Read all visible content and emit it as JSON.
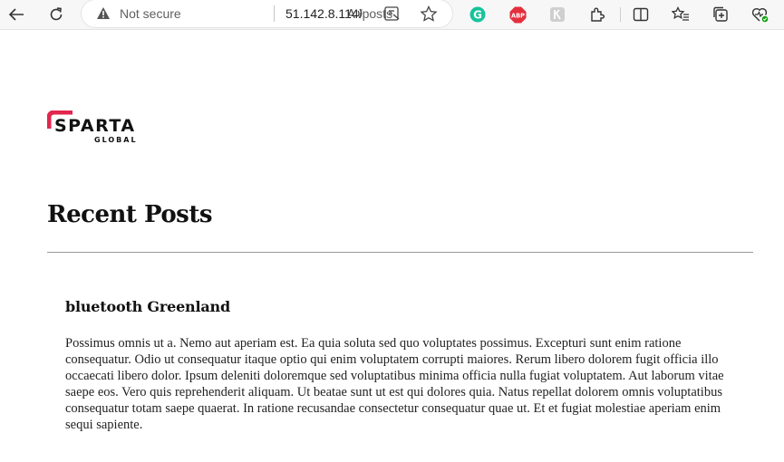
{
  "browser": {
    "security_label": "Not secure",
    "url_host": "51.142.8.114",
    "url_path": "/posts",
    "icons": [
      "back-icon",
      "refresh-icon",
      "warning-icon",
      "read-aloud-icon",
      "immersive-reader-icon",
      "favorite-star-icon",
      "grammarly-icon",
      "adblock-plus-icon",
      "extension-icon",
      "puzzle-extensions-icon",
      "split-screen-icon",
      "favorites-icon",
      "collections-icon",
      "browser-essentials-icon"
    ],
    "abp_label": "ABP"
  },
  "logo": {
    "brand": "SPARTA",
    "sub": "GLOBAL",
    "accent_color": "#e2264d"
  },
  "page": {
    "heading": "Recent Posts"
  },
  "posts": [
    {
      "title": "bluetooth Greenland",
      "body": "Possimus omnis ut a. Nemo aut aperiam est. Ea quia soluta sed quo voluptates possimus. Excepturi sunt enim ratione consequatur. Odio ut consequatur itaque optio qui enim voluptatem corrupti maiores. Rerum libero dolorem fugit officia illo occaecati libero dolor. Ipsum deleniti doloremque sed voluptatibus minima officia nulla fugiat voluptatem. Aut laborum vitae saepe eos. Vero quis reprehenderit aliquam. Ut beatae sunt ut est qui dolores quia. Natus repellat dolorem omnis voluptatibus consequatur totam saepe quaerat. In ratione recusandae consectetur consequatur quae ut. Et et fugiat molestiae aperiam enim sequi sapiente."
    }
  ]
}
